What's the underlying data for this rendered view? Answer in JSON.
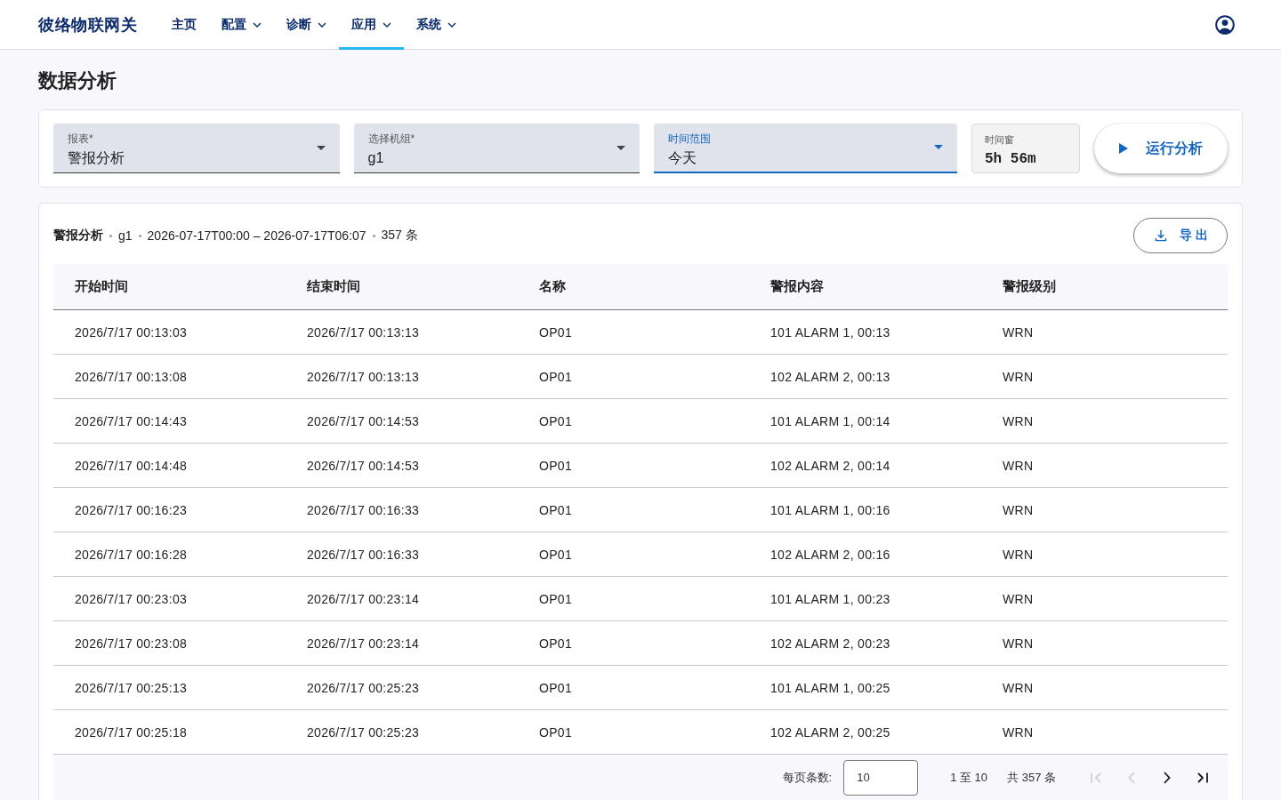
{
  "nav": {
    "brand": "彼络物联网关",
    "items": [
      {
        "label": "主页",
        "dropdown": false,
        "selected": false
      },
      {
        "label": "配置",
        "dropdown": true,
        "selected": false
      },
      {
        "label": "诊断",
        "dropdown": true,
        "selected": false
      },
      {
        "label": "应用",
        "dropdown": true,
        "selected": true
      },
      {
        "label": "系统",
        "dropdown": true,
        "selected": false
      }
    ]
  },
  "page_title": "数据分析",
  "filters": {
    "fields": [
      {
        "kind": "select",
        "label": "报表*",
        "value": "警报分析",
        "focused": false
      },
      {
        "kind": "select",
        "label": "选择机组*",
        "value": "g1",
        "focused": false
      },
      {
        "kind": "select",
        "label": "时间范围",
        "value": "今天",
        "focused": true
      },
      {
        "kind": "readout",
        "label": "时间窗",
        "value": "5h 56m"
      }
    ],
    "run_button": "运行分析"
  },
  "results": {
    "summary": {
      "report": "警报分析",
      "group": "g1",
      "range": "2026-07-17T00:00 – 2026-07-17T06:07",
      "count": "357 条"
    },
    "export_button": "导出",
    "table": {
      "columns": [
        "开始时间",
        "结束时间",
        "名称",
        "警报内容",
        "警报级别"
      ],
      "rows": [
        [
          "2026/7/17 00:13:03",
          "2026/7/17 00:13:13",
          "OP01",
          "101 ALARM 1, 00:13",
          "WRN"
        ],
        [
          "2026/7/17 00:13:08",
          "2026/7/17 00:13:13",
          "OP01",
          "102 ALARM 2, 00:13",
          "WRN"
        ],
        [
          "2026/7/17 00:14:43",
          "2026/7/17 00:14:53",
          "OP01",
          "101 ALARM 1, 00:14",
          "WRN"
        ],
        [
          "2026/7/17 00:14:48",
          "2026/7/17 00:14:53",
          "OP01",
          "102 ALARM 2, 00:14",
          "WRN"
        ],
        [
          "2026/7/17 00:16:23",
          "2026/7/17 00:16:33",
          "OP01",
          "101 ALARM 1, 00:16",
          "WRN"
        ],
        [
          "2026/7/17 00:16:28",
          "2026/7/17 00:16:33",
          "OP01",
          "102 ALARM 2, 00:16",
          "WRN"
        ],
        [
          "2026/7/17 00:23:03",
          "2026/7/17 00:23:14",
          "OP01",
          "101 ALARM 1, 00:23",
          "WRN"
        ],
        [
          "2026/7/17 00:23:08",
          "2026/7/17 00:23:14",
          "OP01",
          "102 ALARM 2, 00:23",
          "WRN"
        ],
        [
          "2026/7/17 00:25:13",
          "2026/7/17 00:25:23",
          "OP01",
          "101 ALARM 1, 00:25",
          "WRN"
        ],
        [
          "2026/7/17 00:25:18",
          "2026/7/17 00:25:23",
          "OP01",
          "102 ALARM 2, 00:25",
          "WRN"
        ]
      ]
    },
    "pagination": {
      "page_size_label": "每页条数:",
      "page_size": "10",
      "range": "1 至 10",
      "total": "共 357 条",
      "buttons": [
        {
          "kind": "first",
          "disabled": true
        },
        {
          "kind": "prev",
          "disabled": true
        },
        {
          "kind": "next",
          "disabled": false
        },
        {
          "kind": "last",
          "disabled": false
        }
      ]
    }
  }
}
